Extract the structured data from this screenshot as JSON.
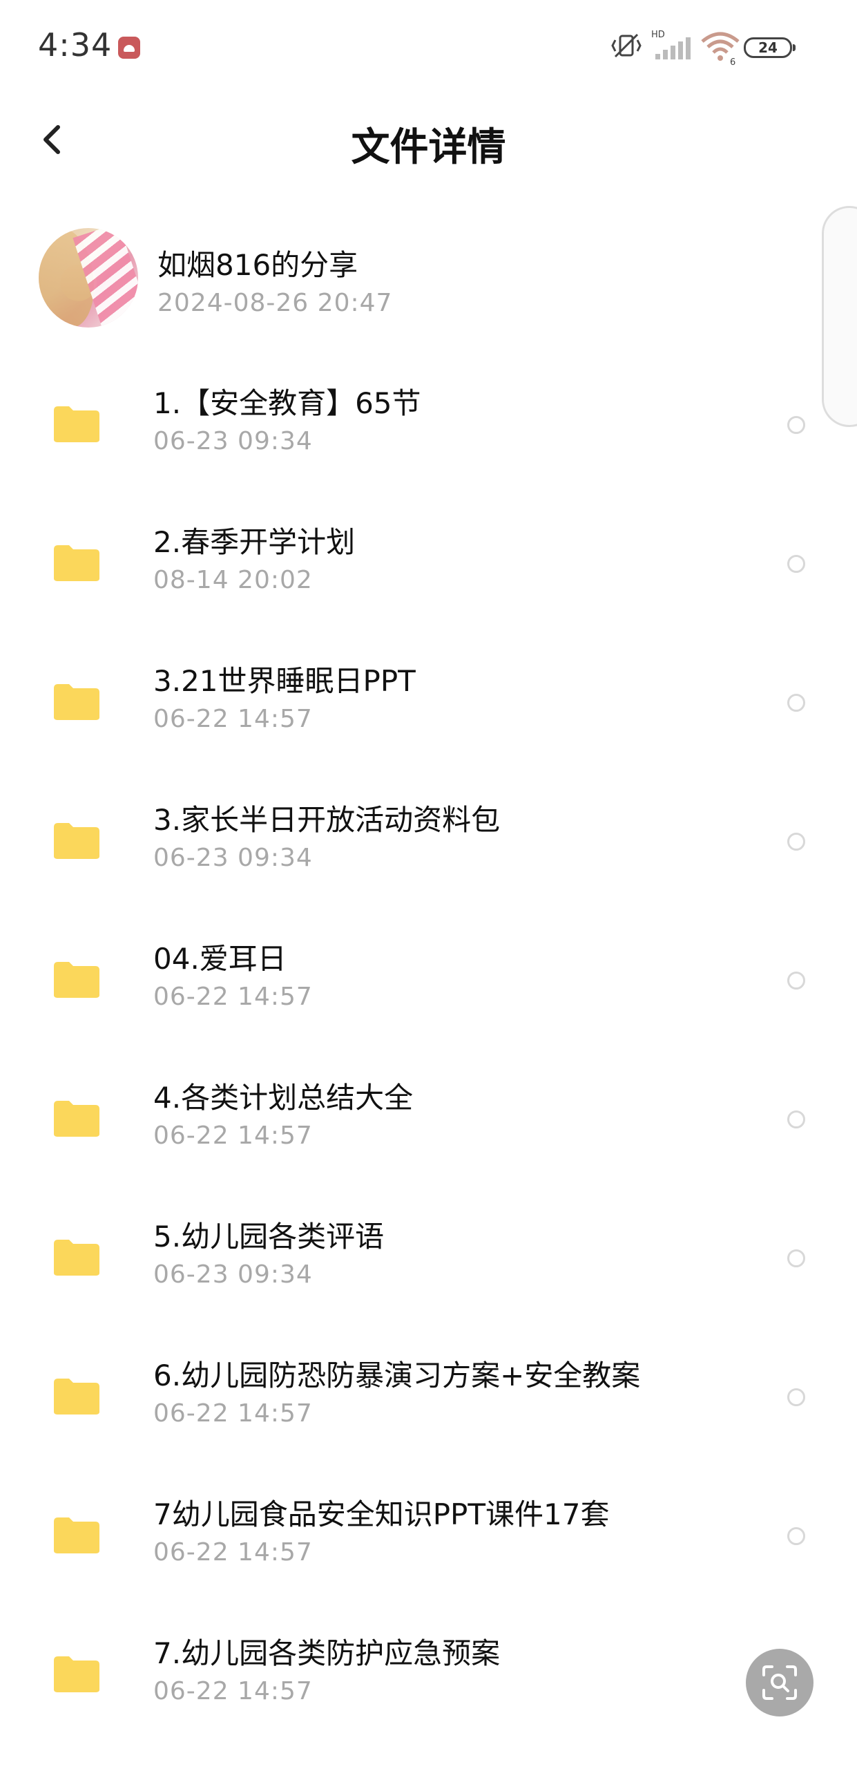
{
  "status_bar": {
    "time": "4:34",
    "battery": "24",
    "network": "HD",
    "wifi_level": "6"
  },
  "header": {
    "title": "文件详情"
  },
  "sharer": {
    "name": "如烟816的分享",
    "date": "2024-08-26  20:47"
  },
  "files": [
    {
      "name": "1.【安全教育】65节",
      "date": "06-23  09:34"
    },
    {
      "name": "2.春季开学计划",
      "date": "08-14  20:02"
    },
    {
      "name": "3.21世界睡眠日PPT",
      "date": "06-22  14:57"
    },
    {
      "name": "3.家长半日开放活动资料包",
      "date": "06-23  09:34"
    },
    {
      "name": "04.爱耳日",
      "date": "06-22  14:57"
    },
    {
      "name": "4.各类计划总结大全",
      "date": "06-22  14:57"
    },
    {
      "name": "5.幼儿园各类评语",
      "date": "06-23  09:34"
    },
    {
      "name": "6.幼儿园防恐防暴演习方案+安全教案",
      "date": "06-22  14:57"
    },
    {
      "name": "7幼儿园食品安全知识PPT课件17套",
      "date": "06-22  14:57"
    },
    {
      "name": "7.幼儿园各类防护应急预案",
      "date": "06-22  14:57"
    }
  ],
  "colors": {
    "folder": "#fbd75b",
    "secondary_text": "#a8a8a8"
  },
  "icons": {
    "back": "chevron-left-icon",
    "folder": "folder-icon",
    "fab": "scan-search-icon"
  }
}
